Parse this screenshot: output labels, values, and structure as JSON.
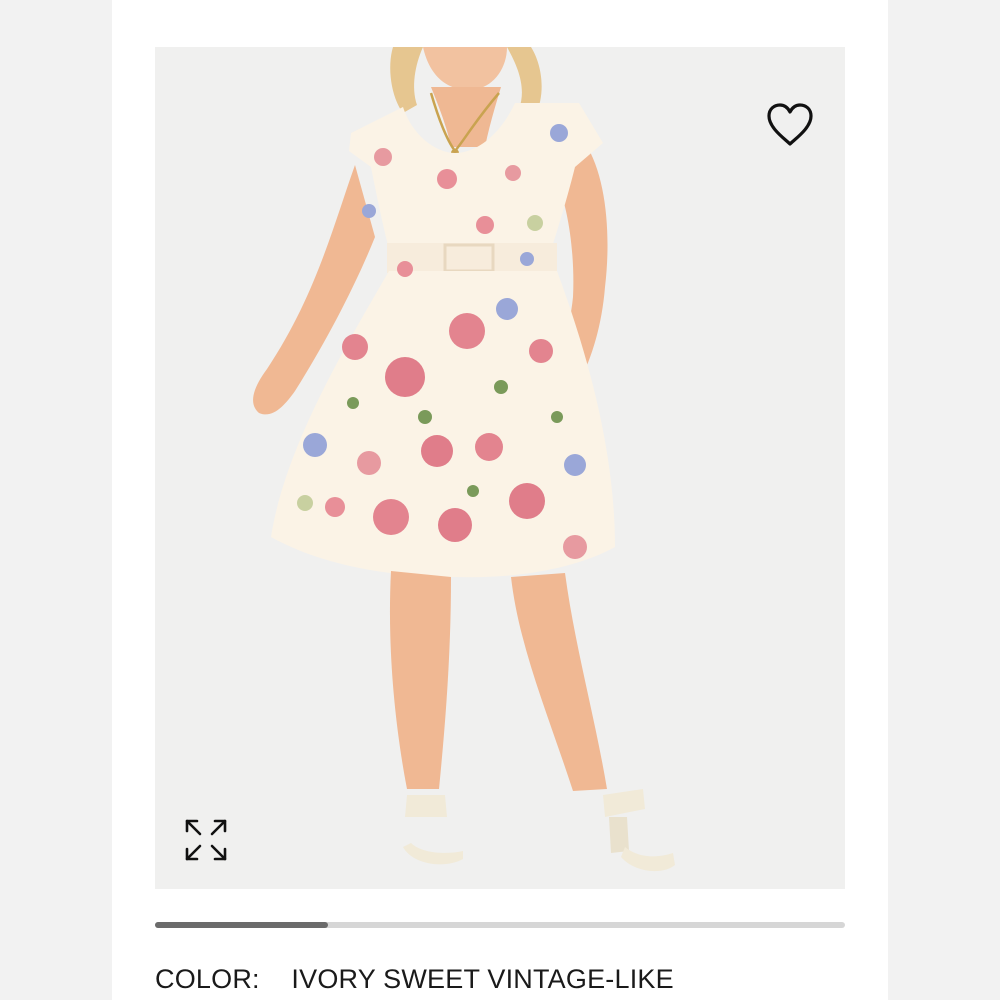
{
  "product": {
    "image_alt": "Woman wearing ivory floral print fit and flare dress",
    "wishlist_icon": "heart-outline-icon",
    "expand_icon": "expand-arrows-icon"
  },
  "gallery": {
    "progress_fraction": 0.25
  },
  "color": {
    "label": "COLOR:",
    "value": "IVORY SWEET VINTAGE-LIKE"
  },
  "colors": {
    "page_bg": "#ffffff",
    "side_bg": "#f2f2f2",
    "image_bg": "#f0f0ef",
    "progress_track": "#d6d6d6",
    "progress_fill": "#6b6b6b",
    "text": "#1a1a1a"
  }
}
